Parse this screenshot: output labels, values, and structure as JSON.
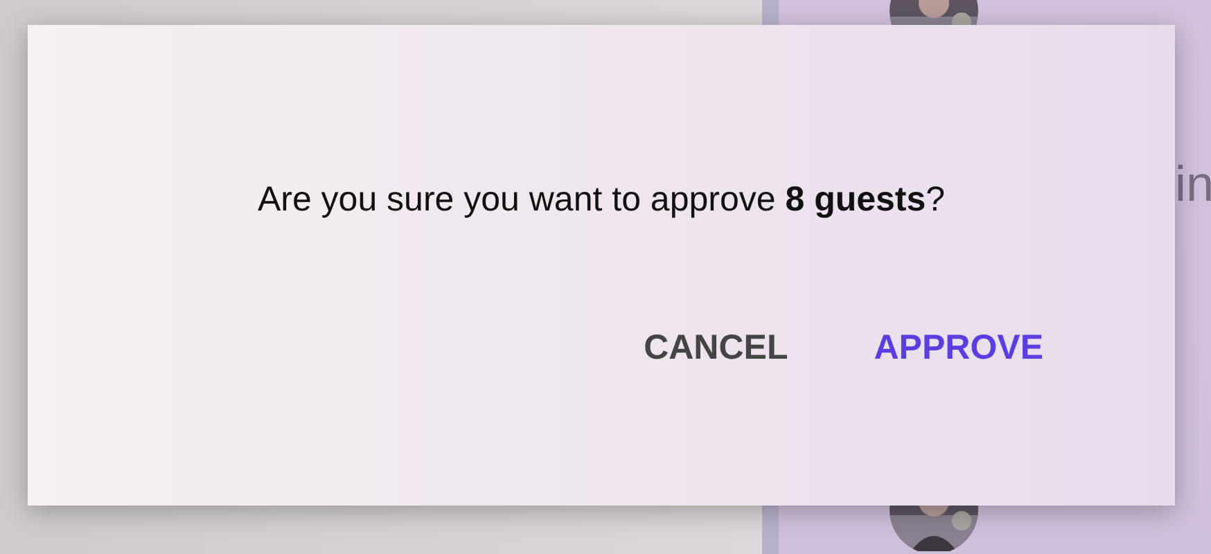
{
  "background_list": [
    {
      "kind": "avatar"
    },
    {
      "kind": "text",
      "text": "in"
    },
    {
      "kind": "avatar"
    }
  ],
  "dialog": {
    "message": "Are you sure you want to approve **8 guests**?",
    "buttons": [
      {
        "label": "CANCEL",
        "kind": "secondary"
      },
      {
        "label": "APPROVE",
        "kind": "primary"
      }
    ]
  }
}
